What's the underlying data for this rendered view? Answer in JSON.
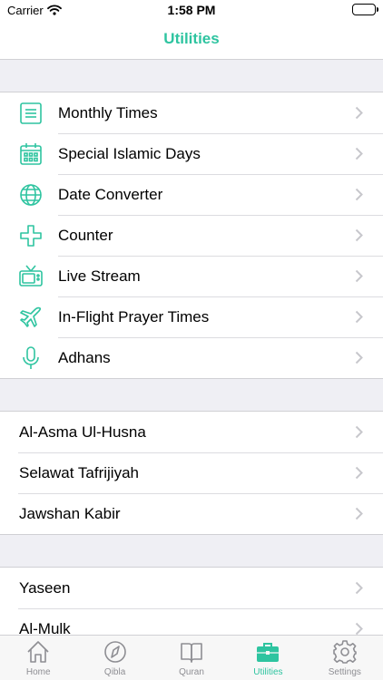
{
  "status_bar": {
    "carrier": "Carrier",
    "time": "1:58 PM"
  },
  "header": {
    "title": "Utilities"
  },
  "groups": {
    "tools": [
      {
        "label": "Monthly Times",
        "icon": "list-icon"
      },
      {
        "label": "Special Islamic Days",
        "icon": "calendar-icon"
      },
      {
        "label": "Date Converter",
        "icon": "globe-icon"
      },
      {
        "label": "Counter",
        "icon": "plus-icon"
      },
      {
        "label": "Live Stream",
        "icon": "tv-icon"
      },
      {
        "label": "In-Flight Prayer Times",
        "icon": "airplane-icon"
      },
      {
        "label": "Adhans",
        "icon": "microphone-icon"
      }
    ],
    "prayers": [
      {
        "label": "Al-Asma Ul-Husna"
      },
      {
        "label": "Selawat Tafrijiyah"
      },
      {
        "label": "Jawshan Kabir"
      }
    ],
    "surahs": [
      {
        "label": "Yaseen"
      },
      {
        "label": "Al-Mulk"
      }
    ]
  },
  "tabs": [
    {
      "label": "Home",
      "icon": "home-icon"
    },
    {
      "label": "Qibla",
      "icon": "compass-icon"
    },
    {
      "label": "Quran",
      "icon": "book-icon"
    },
    {
      "label": "Utilities",
      "icon": "briefcase-icon",
      "active": true
    },
    {
      "label": "Settings",
      "icon": "gear-icon"
    }
  ],
  "colors": {
    "accent": "#2ec4a0",
    "inactive": "#8e8e93",
    "background": "#efeff4"
  }
}
